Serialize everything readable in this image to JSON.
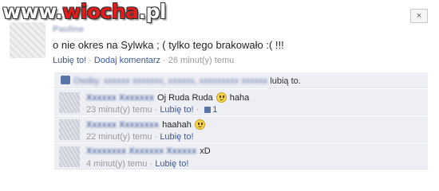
{
  "watermark": {
    "prefix": "www.",
    "accent": "wiocha",
    "suffix": ".pl"
  },
  "close_icon": "×",
  "post": {
    "author": "Pauline",
    "text": "o nie okres na Sylwka ; ( tylko tego brakowało :( !!!",
    "like_label": "Lubię to!",
    "separator": "·",
    "comment_label": "Dodaj komentarz",
    "time": "26 minut(y) temu"
  },
  "likes": {
    "names_obscured": "Osoby: xxxxxx xxxxxxx, xxxxxx, xxxxxxxxx xxxxxx",
    "tail": "lubią to."
  },
  "comments": [
    {
      "name": "Xxxxxx Xxxxxxx",
      "text": "Oj Ruda Ruda",
      "after_emoticon": "haha",
      "emoticon": true,
      "time": "23 minut(y) temu",
      "like_label": "Lubię to!",
      "like_count": "1"
    },
    {
      "name": "Xxxxxx Xxxxxxxx",
      "text": "",
      "after_emoticon": "haahah",
      "emoticon": true,
      "time": "22 minut(y) temu",
      "like_label": "Lubię to!",
      "like_count": ""
    },
    {
      "name": "Xxxxxxxx Xxxxxxx Xxxxxx",
      "text": "xD",
      "after_emoticon": "",
      "emoticon": false,
      "time": "4 minut(y) temu",
      "like_label": "Lubię to!",
      "like_count": ""
    }
  ]
}
